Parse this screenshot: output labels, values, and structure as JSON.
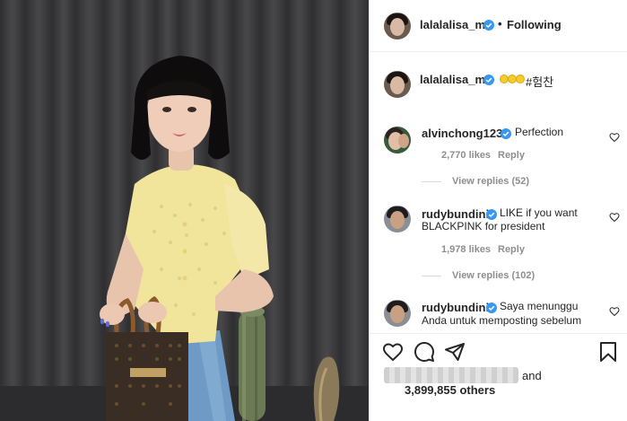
{
  "post": {
    "author": "lalalalisa_m",
    "follow_dot": "•",
    "follow_status": "Following"
  },
  "caption": {
    "username": "lalalalisa_m",
    "hashtag": "#험찬",
    "emoji": "lemon-emoji"
  },
  "comments": [
    {
      "username": "alvinchong123",
      "text": "Perfection",
      "likes": "2,770 likes",
      "reply_label": "Reply",
      "view_replies": "View replies (52)"
    },
    {
      "username": "rudybundini",
      "text_line1": "LIKE if you want",
      "text_line2": "BLACKPINK for president",
      "likes": "1,978 likes",
      "reply_label": "Reply",
      "view_replies": "View replies (102)"
    },
    {
      "username": "rudybundini",
      "text_line1": "Saya menunggu",
      "text_line2": "Anda untuk memposting sebelum"
    }
  ],
  "actions": {
    "like_icon": "heart-icon",
    "comment_icon": "comment-icon",
    "share_icon": "share-icon",
    "save_icon": "bookmark-icon"
  },
  "likes_summary": {
    "and_text": "and",
    "others_count": "3,899,855 others"
  },
  "colors": {
    "verified_blue": "#3897f0",
    "text_primary": "#262626",
    "text_secondary": "#8e8e8e",
    "border": "#efefef",
    "sweater": "#f1e49b",
    "jeans": "#6f9ac6",
    "curtain": "#3f3f41"
  }
}
